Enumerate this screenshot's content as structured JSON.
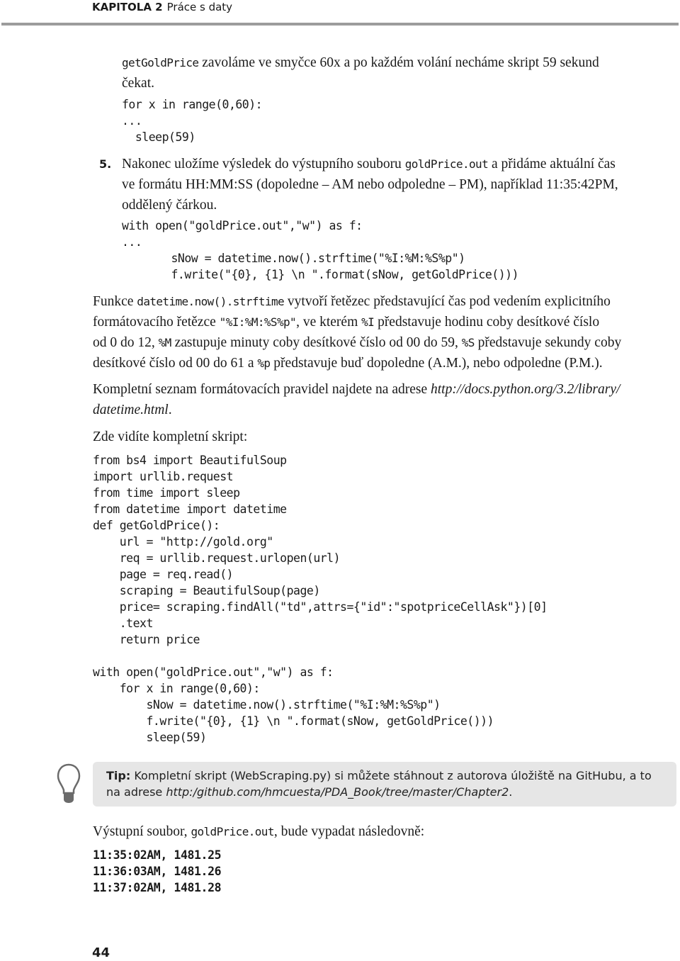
{
  "header": {
    "chapter": "KAPITOLA 2",
    "section": "Práce s daty"
  },
  "step4": {
    "text_code": "getGoldPrice",
    "text_line1": " zavoláme ve smyčce 60x a po každém volání necháme skript 59 sekund",
    "text_line2": "čekat.",
    "code": [
      "for x in range(0,60):",
      "...",
      "  sleep(59)"
    ]
  },
  "step5": {
    "number": "5.",
    "line1_a": "Nakonec uložíme výsledek do výstupního souboru ",
    "line1_code": "goldPrice.out",
    "line1_b": " a přidáme aktuální čas",
    "line2": "ve formátu HH:MM:SS (dopoledne – AM nebo odpoledne – PM), například 11:35:42PM,",
    "line3": "oddělený čárkou.",
    "code": [
      "with open(\"goldPrice.out\",\"w\") as f:",
      "...",
      "        sNow = datetime.now().strftime(\"%I:%M:%S%p\")",
      "        f.write(\"{0}, {1} \\n \".format(sNow, getGoldPrice()))"
    ]
  },
  "explanation": {
    "l1_a": "Funkce ",
    "l1_code": "datetime.now().strftime",
    "l1_b": " vytvoří řetězec představující čas pod vedením explicitního",
    "l2_a": "formátovacího řetězce ",
    "l2_code": "\"%I:%M:%S%p\"",
    "l2_b": ", ve kterém ",
    "l2_code2": "%I",
    "l2_c": " představuje hodinu coby desítkové číslo",
    "l3_a": "od 0 do 12, ",
    "l3_code": "%M",
    "l3_b": " zastupuje minuty coby desítkové číslo od 00 do 59, ",
    "l3_code2": "%S",
    "l3_c": " představuje sekundy coby",
    "l4_a": "desítkové číslo od 00 do 61 a ",
    "l4_code": "%p",
    "l4_b": " představuje buď dopoledne (A.M.), nebo odpoledne (P.M.)."
  },
  "reference": {
    "line1_text": "Kompletní seznam formátovacích pravidel najdete na adrese ",
    "line1_link": "http://docs.python.org/3.2/library/",
    "line2_link": "datetime.html",
    "line2_end": "."
  },
  "full_script": {
    "intro": "Zde vidíte kompletní skript:",
    "code": [
      "from bs4 import BeautifulSoup",
      "import urllib.request",
      "from time import sleep",
      "from datetime import datetime",
      "def getGoldPrice():",
      "    url = \"http://gold.org\"",
      "    req = urllib.request.urlopen(url)",
      "    page = req.read()",
      "    scraping = BeautifulSoup(page)",
      "    price= scraping.findAll(\"td\",attrs={\"id\":\"spotpriceCellAsk\"})[0]",
      "    .text",
      "    return price",
      "",
      "with open(\"goldPrice.out\",\"w\") as f:",
      "    for x in range(0,60):",
      "        sNow = datetime.now().strftime(\"%I:%M:%S%p\")",
      "        f.write(\"{0}, {1} \\n \".format(sNow, getGoldPrice()))",
      "        sleep(59)"
    ]
  },
  "tip": {
    "icon": "lightbulb-icon",
    "label": "Tip:",
    "line1": " Kompletní skript (WebScraping.py) si můžete stáhnout z autorova úložiště na GitHubu, a to",
    "line2_a": "na adrese ",
    "line2_link": "http:/github.com/hmcuesta/PDA_Book/tree/master/Chapter2",
    "line2_end": "."
  },
  "output": {
    "intro_a": "Výstupní soubor, ",
    "intro_code": "goldPrice.out",
    "intro_b": ", bude vypadat následovně:",
    "lines": [
      "11:35:02AM, 1481.25",
      "11:36:03AM, 1481.26",
      "11:37:02AM, 1481.28"
    ]
  },
  "page_number": "44"
}
